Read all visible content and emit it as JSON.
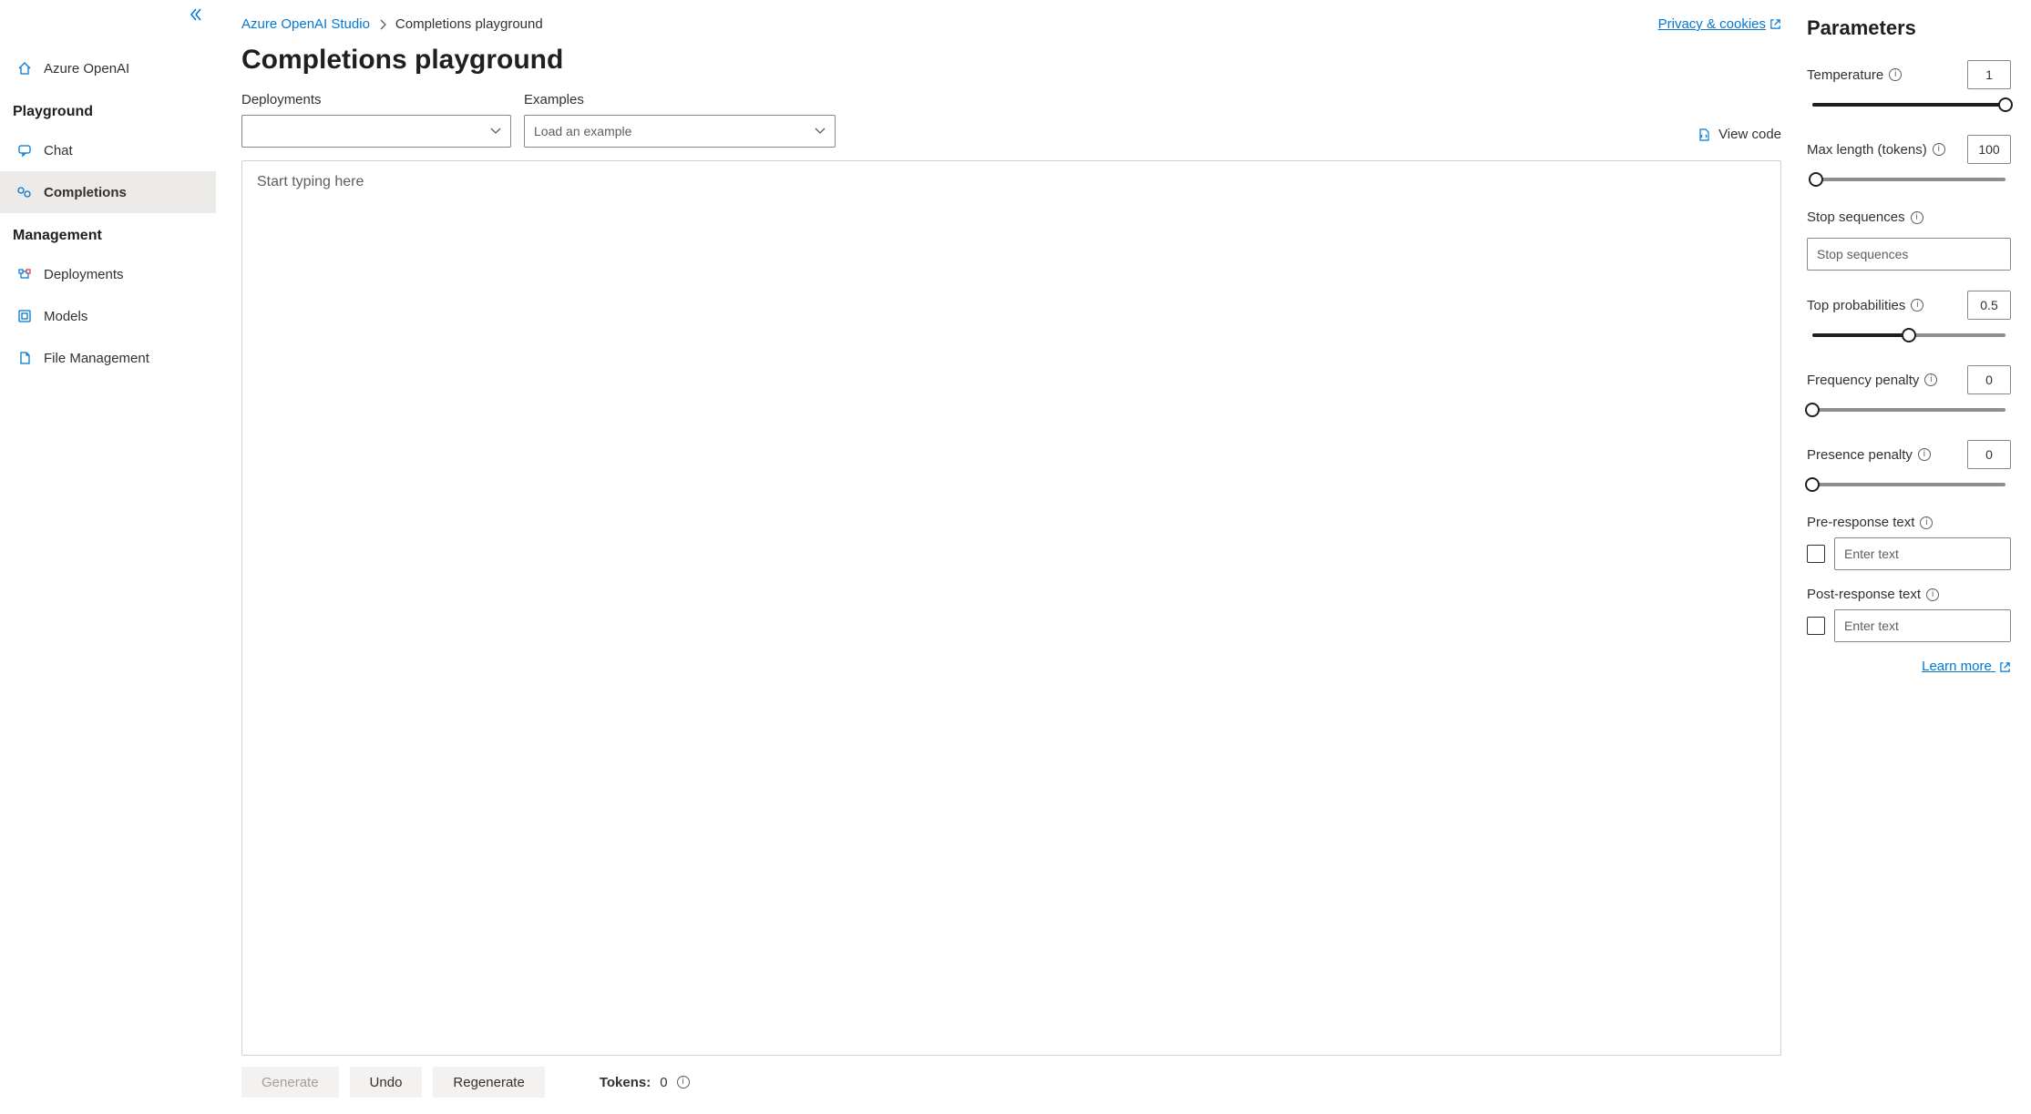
{
  "sidebar": {
    "home_label": "Azure OpenAI",
    "section_playground": "Playground",
    "section_management": "Management",
    "items": {
      "chat": "Chat",
      "completions": "Completions",
      "deployments": "Deployments",
      "models": "Models",
      "file_management": "File Management"
    }
  },
  "breadcrumb": {
    "root": "Azure OpenAI Studio",
    "current": "Completions playground"
  },
  "privacy_label": "Privacy & cookies",
  "page_title": "Completions playground",
  "selectors": {
    "deployments_label": "Deployments",
    "examples_label": "Examples",
    "examples_placeholder": "Load an example",
    "view_code": "View code"
  },
  "editor": {
    "placeholder": "Start typing here"
  },
  "buttons": {
    "generate": "Generate",
    "undo": "Undo",
    "regenerate": "Regenerate"
  },
  "tokens": {
    "label": "Tokens:",
    "value": "0"
  },
  "params": {
    "title": "Parameters",
    "temperature": {
      "label": "Temperature",
      "value": "1",
      "fill_pct": 100
    },
    "max_length": {
      "label": "Max length (tokens)",
      "value": "100",
      "fill_pct": 2
    },
    "stop": {
      "label": "Stop sequences",
      "placeholder": "Stop sequences"
    },
    "top_p": {
      "label": "Top probabilities",
      "value": "0.5",
      "fill_pct": 50
    },
    "freq_penalty": {
      "label": "Frequency penalty",
      "value": "0",
      "fill_pct": 0
    },
    "pres_penalty": {
      "label": "Presence penalty",
      "value": "0",
      "fill_pct": 0
    },
    "pre_response": {
      "label": "Pre-response text",
      "placeholder": "Enter text"
    },
    "post_response": {
      "label": "Post-response text",
      "placeholder": "Enter text"
    },
    "learn_more": "Learn more"
  }
}
